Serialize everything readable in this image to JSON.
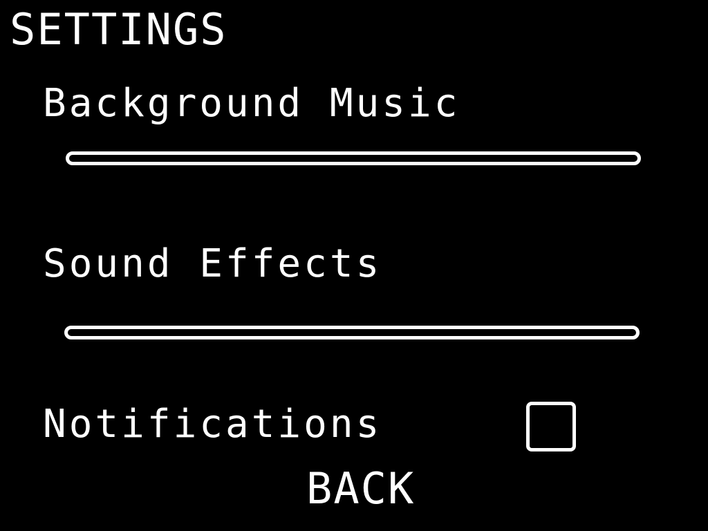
{
  "screen": {
    "title": "SETTINGS",
    "background_color": "#000000",
    "foreground_color": "#ffffff"
  },
  "settings": {
    "background_music": {
      "label": "Background Music",
      "level": 0
    },
    "sound_effects": {
      "label": "Sound Effects",
      "level": 0
    },
    "notifications": {
      "label": "Notifications",
      "checked": false
    }
  },
  "back_button": {
    "label": "BACK"
  }
}
